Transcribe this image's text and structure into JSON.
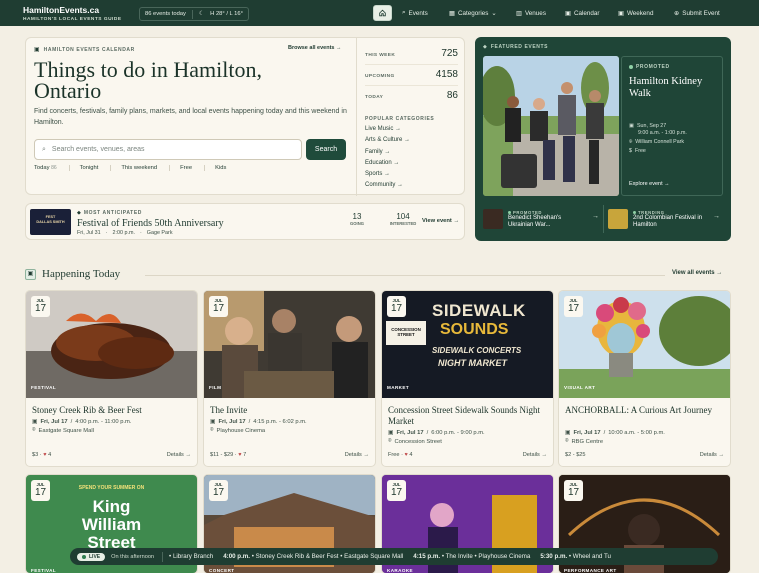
{
  "header": {
    "site_name": "HamiltonEvents.ca",
    "tagline": "HAMILTON'S LOCAL EVENTS GUIDE",
    "events_today": "86 events today",
    "weather": "H 28° / L 16°",
    "nav": [
      {
        "label": "Events",
        "icon": "search-icon"
      },
      {
        "label": "Categories",
        "icon": "grid-icon"
      },
      {
        "label": "Venues",
        "icon": "building-icon"
      },
      {
        "label": "Calendar",
        "icon": "calendar-icon"
      },
      {
        "label": "Weekend",
        "icon": "calendar-icon"
      },
      {
        "label": "Submit Event",
        "icon": "plus-circle-icon"
      }
    ]
  },
  "hero": {
    "eyebrow": "HAMILTON EVENTS CALENDAR",
    "browse": "Browse all events →",
    "title": "Things to do in Hamilton, Ontario",
    "subtitle": "Find concerts, festivals, family plans, markets, and local events happening today and this weekend in Hamilton.",
    "search_placeholder": "Search events, venues, areas",
    "search_button": "Search",
    "quick_filters": [
      {
        "label": "Today",
        "count": "86"
      },
      {
        "label": "Tonight",
        "count": ""
      },
      {
        "label": "This weekend",
        "count": ""
      },
      {
        "label": "Free",
        "count": ""
      },
      {
        "label": "Kids",
        "count": ""
      }
    ],
    "stats": [
      {
        "label": "THIS WEEK",
        "value": "725"
      },
      {
        "label": "UPCOMING",
        "value": "4158"
      },
      {
        "label": "TODAY",
        "value": "86"
      }
    ],
    "popular_label": "POPULAR CATEGORIES",
    "categories": [
      "Live Music →",
      "Arts & Culture →",
      "Family →",
      "Education →",
      "Sports →",
      "Community →"
    ]
  },
  "anticipated": {
    "thumb_text": "FEST\nDALLAS SMITH",
    "eyebrow": "MOST ANTICIPATED",
    "title": "Festival of Friends 50th Anniversary",
    "date": "Fri, Jul 31",
    "time": "2:00 p.m.",
    "venue": "Gage Park",
    "going_count": "13",
    "going_label": "GOING",
    "interested_count": "104",
    "interested_label": "INTERESTED",
    "link": "View event →"
  },
  "featured": {
    "eyebrow": "FEATURED EVENTS",
    "promo_tag": "PROMOTED",
    "title": "Hamilton Kidney Walk",
    "date": "Sun, Sep 27",
    "time": "9:00 a.m. - 1:00 p.m.",
    "venue": "William Connell Park",
    "price": "Free",
    "link": "Explore event →",
    "mini": [
      {
        "tag": "PROMOTED",
        "title": "Benedict Sheehan's Ukrainian War..."
      },
      {
        "tag": "TRENDING",
        "title": "2nd Colombian Festival in Hamilton"
      }
    ]
  },
  "today_section": {
    "title": "Happening Today",
    "view_all": "View all events →"
  },
  "cards": [
    {
      "month": "JUL",
      "day": "17",
      "tag": "FESTIVAL",
      "title": "Stoney Creek Rib & Beer Fest",
      "date": "Fri, Jul 17",
      "time": "4:00 p.m. - 11:00 p.m.",
      "venue": "Eastgate Square Mall",
      "price": "$3",
      "likes": "4",
      "details": "Details →"
    },
    {
      "month": "JUL",
      "day": "17",
      "tag": "FILM",
      "title": "The Invite",
      "date": "Fri, Jul 17",
      "time": "4:15 p.m. - 6:02 p.m.",
      "venue": "Playhouse Cinema",
      "price": "$11 - $29",
      "likes": "7",
      "details": "Details →"
    },
    {
      "month": "JUL",
      "day": "17",
      "tag": "MARKET",
      "title": "Concession Street Sidewalk Sounds Night Market",
      "date": "Fri, Jul 17",
      "time": "6:00 p.m. - 9:00 p.m.",
      "venue": "Concession Street",
      "price": "Free",
      "likes": "4",
      "details": "Details →"
    },
    {
      "month": "JUL",
      "day": "17",
      "tag": "VISUAL ART",
      "title": "ANCHORBALL: A Curious Art Journey",
      "date": "Fri, Jul 17",
      "time": "10:00 a.m. - 5:00 p.m.",
      "venue": "RBG Centre",
      "price": "$2 - $25",
      "likes": "",
      "details": "Details →"
    }
  ],
  "poster_text": {
    "sidewalk_line1": "SIDEWALK",
    "sidewalk_line2": "SOUNDS",
    "sidewalk_line3": "SIDEWALK CONCERTS",
    "sidewalk_line4": "NIGHT MARKET",
    "concession": "CONCESSION STREET",
    "king1": "SPEND YOUR SUMMER ON",
    "king2": "King",
    "king3": "William",
    "king4": "Street"
  },
  "row2": [
    {
      "month": "JUL",
      "day": "17",
      "tag": "FESTIVAL"
    },
    {
      "month": "JUL",
      "day": "17",
      "tag": "CONCERT"
    },
    {
      "month": "JUL",
      "day": "17",
      "tag": "KARAOKE"
    },
    {
      "month": "JUL",
      "day": "17",
      "tag": "PERFORMANCE ART"
    }
  ],
  "ticker": {
    "live": "LIVE",
    "label": "On this afternoon",
    "items": [
      {
        "time": "",
        "text": "Library Branch"
      },
      {
        "time": "4:00 p.m.",
        "text": "Stoney Creek Rib & Beer Fest",
        "venue": "Eastgate Square Mall"
      },
      {
        "time": "4:15 p.m.",
        "text": "The Invite",
        "venue": "Playhouse Cinema"
      },
      {
        "time": "5:30 p.m.",
        "text": "Wheel and Tu",
        "venue": ""
      }
    ]
  }
}
